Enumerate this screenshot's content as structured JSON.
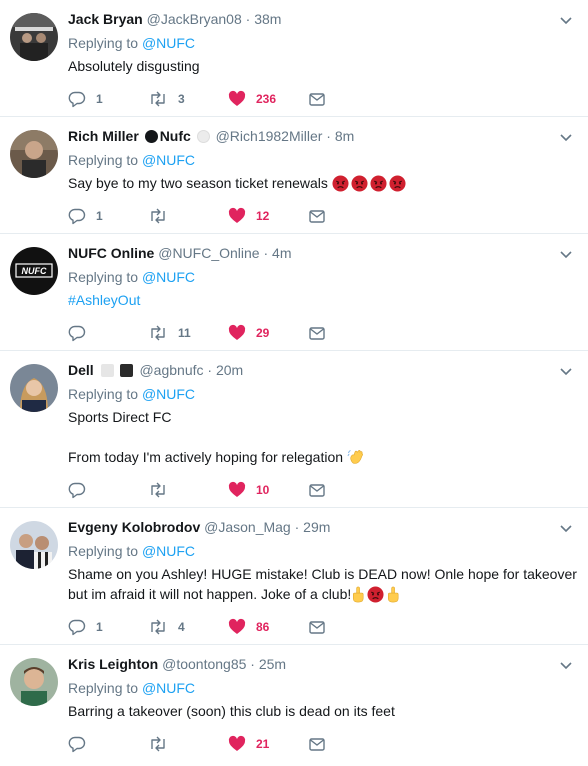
{
  "reply_prefix": "Replying to ",
  "tweets": [
    {
      "name": "Jack Bryan",
      "handle": "@JackBryan08",
      "time": "38m",
      "reply_to": "@NUFC",
      "text": "Absolutely disgusting",
      "replies": "1",
      "retweets": "3",
      "likes": "236"
    },
    {
      "name": "Rich Miller",
      "name_suffix": "Nufc",
      "handle": "@Rich1982Miller",
      "time": "8m",
      "reply_to": "@NUFC",
      "text": "Say bye to my two season ticket renewals",
      "text_emoji": [
        "angry-face-emoji",
        "angry-face-emoji",
        "angry-face-emoji",
        "angry-face-emoji"
      ],
      "replies": "1",
      "retweets": "",
      "likes": "12"
    },
    {
      "name": "NUFC Online",
      "handle": "@NUFC_Online",
      "time": "4m",
      "reply_to": "@NUFC",
      "hashtag": "#AshleyOut",
      "avatar_logo": "NUFC",
      "replies": "",
      "retweets": "11",
      "likes": "29"
    },
    {
      "name": "Dell",
      "handle": "@agbnufc",
      "time": "20m",
      "reply_to": "@NUFC",
      "text": "Sports Direct FC\n\nFrom today I'm actively hoping for relegation",
      "text_emoji": [
        "waving-hand-emoji"
      ],
      "replies": "",
      "retweets": "",
      "likes": "10"
    },
    {
      "name": "Evgeny Kolobrodov",
      "handle": "@Jason_Mag",
      "time": "29m",
      "reply_to": "@NUFC",
      "text": "Shame on you Ashley! HUGE mistake! Club is DEAD now! Onle hope for takeover but im afraid it will not happen. Joke of a club!",
      "text_emoji": [
        "middle-finger-emoji",
        "angry-face-emoji",
        "middle-finger-emoji"
      ],
      "replies": "1",
      "retweets": "4",
      "likes": "86"
    },
    {
      "name": "Kris Leighton",
      "handle": "@toontong85",
      "time": "25m",
      "reply_to": "@NUFC",
      "text": "Barring a takeover (soon) this club is dead on its feet",
      "replies": "",
      "retweets": "",
      "likes": "21"
    }
  ],
  "icons": {
    "reply": "reply-icon",
    "retweet": "retweet-icon",
    "like": "heart-icon",
    "dm": "envelope-icon",
    "caret": "chevron-down-icon"
  },
  "colors": {
    "link": "#1da1f2",
    "like": "#e0245e",
    "secondary_text": "#657786",
    "divider": "#e6ecf0"
  },
  "separator": "·"
}
